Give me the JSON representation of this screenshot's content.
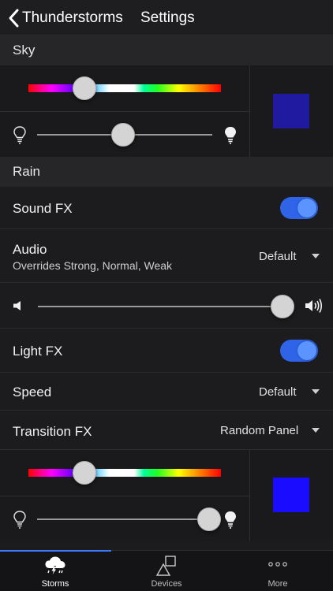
{
  "nav": {
    "back_label": "Thunderstorms",
    "title": "Settings"
  },
  "sky": {
    "header": "Sky",
    "hue_position": 0.29,
    "brightness_position": 0.49,
    "swatch_color": "#1f1aa0"
  },
  "rain": {
    "header": "Rain",
    "sound_fx": {
      "label": "Sound FX",
      "on": true
    },
    "audio": {
      "label": "Audio",
      "sublabel": "Overrides Strong, Normal, Weak",
      "value": "Default"
    },
    "volume_position": 1.0,
    "light_fx": {
      "label": "Light FX",
      "on": true
    },
    "speed": {
      "label": "Speed",
      "value": "Default"
    },
    "transition_fx": {
      "label": "Transition FX",
      "value": "Random Panel"
    },
    "hue_position": 0.29,
    "brightness_position": 0.98,
    "swatch_color": "#1a0dff"
  },
  "tabs": [
    {
      "label": "Storms",
      "icon": "storm-cloud-icon",
      "active": true
    },
    {
      "label": "Devices",
      "icon": "devices-icon",
      "active": false
    },
    {
      "label": "More",
      "icon": "more-dots-icon",
      "active": false
    }
  ],
  "colors": {
    "accent": "#2f63e8",
    "tab_indicator": "#3a7bff"
  }
}
